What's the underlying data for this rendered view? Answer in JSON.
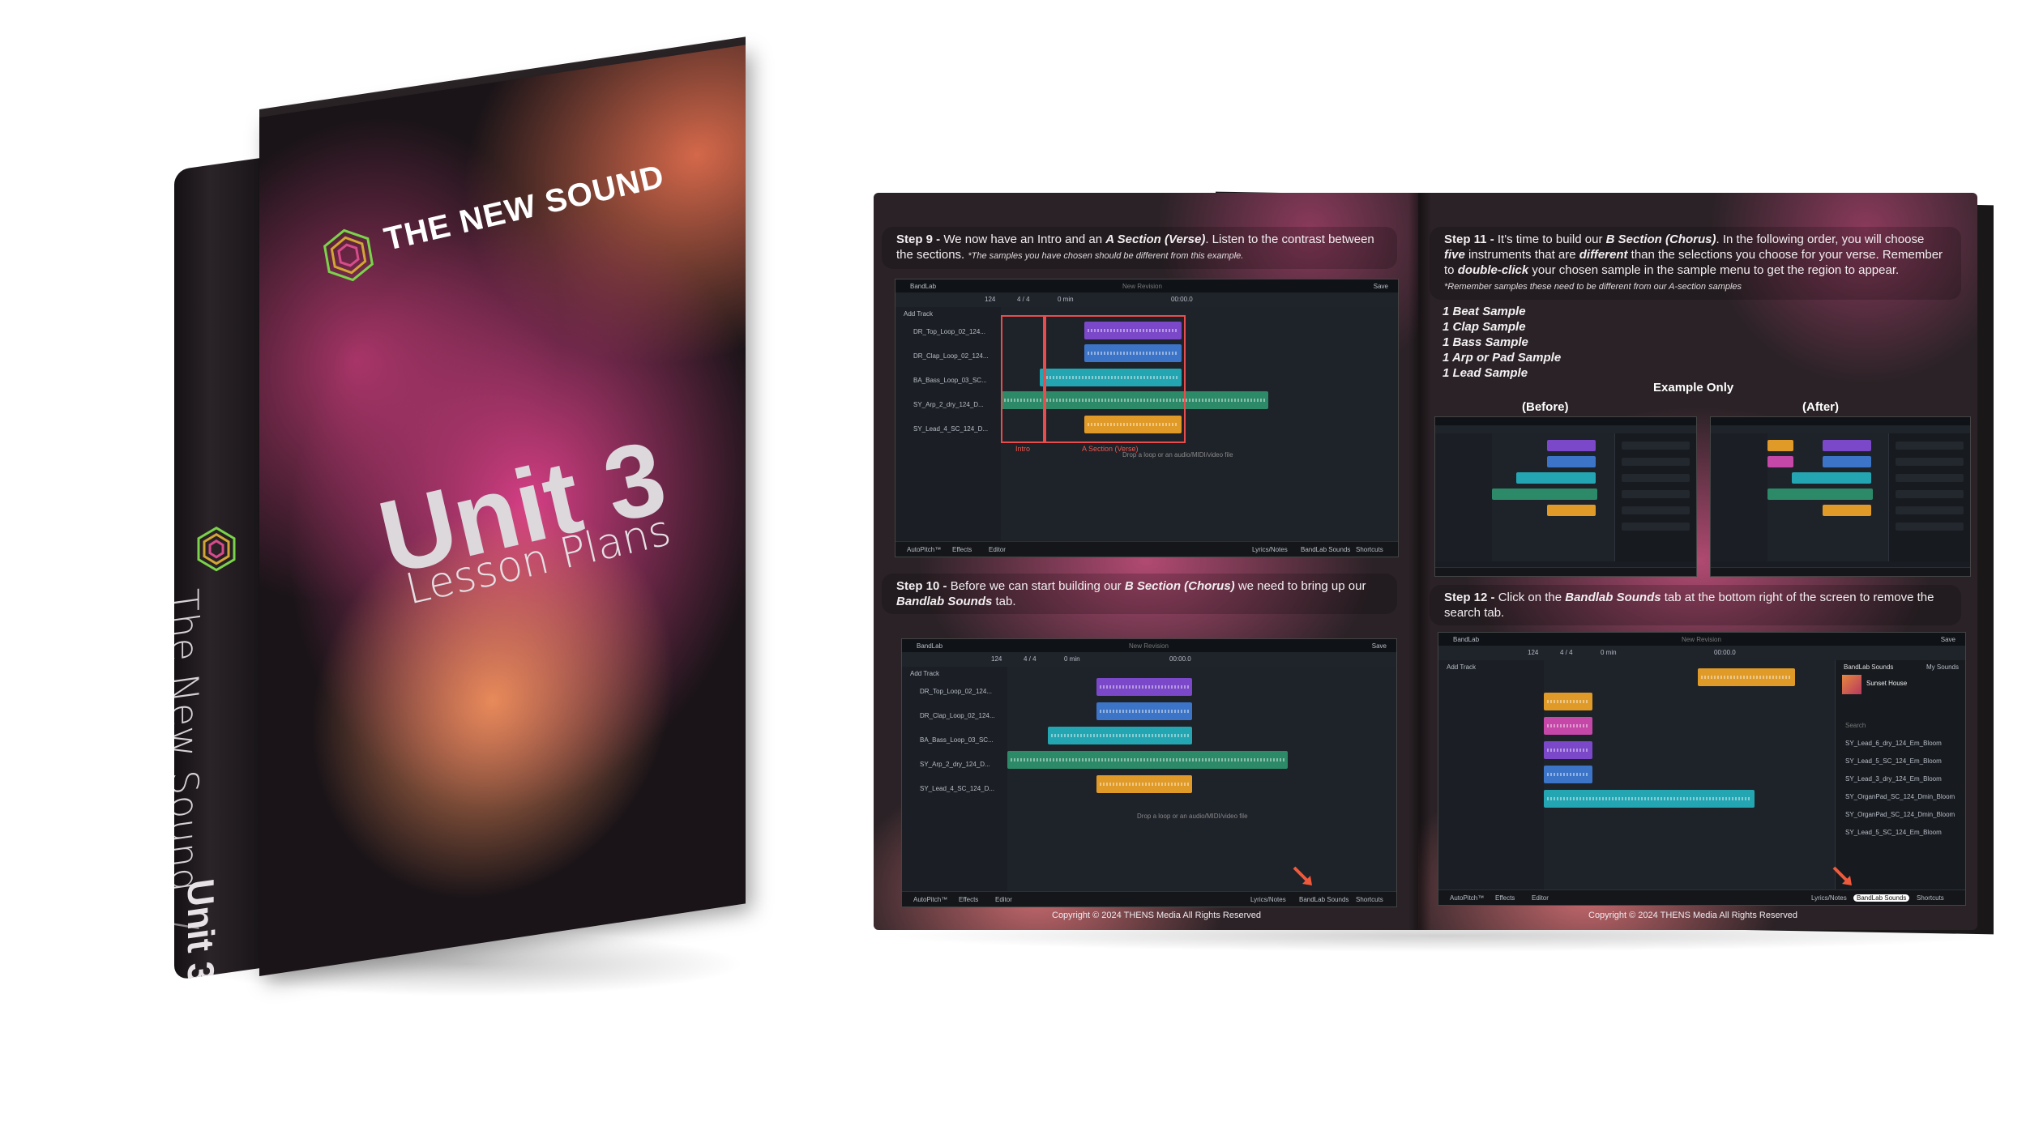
{
  "book": {
    "cover_title": "THE NEW SOUND",
    "cover_unit": "Unit 3",
    "cover_subtitle": "Lesson Plans",
    "spine_title": "The New Sound",
    "spine_divider": "/",
    "spine_unit": "Unit 3",
    "logo_icon": "hexagon-spiral-logo-icon"
  },
  "workbook": {
    "step9": {
      "label": "Step 9 -",
      "text_a": " We now have an Intro and an ",
      "emph": "A Section (Verse)",
      "text_b": ". Listen to the contrast between the sections. ",
      "note": "*The samples you have chosen should be different from this example."
    },
    "step10": {
      "label": "Step 10 -",
      "text_a": " Before we can start building our ",
      "emph": "B Section (Chorus)",
      "text_b": " we need to bring up our ",
      "emph2": "Bandlab Sounds",
      "text_c": " tab."
    },
    "step11": {
      "label": "Step 11 -",
      "text_a": " It's time to build our ",
      "emph": "B Section (Chorus)",
      "text_b": ". In the following order, you will choose ",
      "emph2": "five",
      "text_c": " instruments that are ",
      "emph3": "different",
      "text_d": " than the selections you choose for your verse. Remember to ",
      "emph4": "double-click",
      "text_e": " your chosen sample in the sample menu to get the region to appear. ",
      "note": "*Remember samples these need to be different from our A-section samples"
    },
    "step11_list": [
      "1 Beat Sample",
      "1 Clap Sample",
      "1 Bass Sample",
      "1 Arp or Pad  Sample",
      "1 Lead Sample"
    ],
    "example_label": "Example Only",
    "before_label": "(Before)",
    "after_label": "(After)",
    "step12": {
      "label": "Step 12 -",
      "text_a": " Click on the ",
      "emph": "Bandlab Sounds",
      "text_b": " tab at the bottom right of the screen to remove the search tab."
    },
    "copyright_left": "Copyright © 2024 THENS Media All Rights Reserved",
    "copyright_right": "Copyright © 2024 THENS Media All Rights Reserved",
    "daw": {
      "app_name": "BandLab",
      "project": "New Revision",
      "save": "Save",
      "bpm": "124",
      "sig": "4 / 4",
      "time": "0 min",
      "clock": "00:00.0",
      "add_track": "Add Track",
      "drop_hint": "Drop a loop or an audio/MIDI/video file",
      "intro_label": "Intro",
      "verse_label": "A Section (Verse)",
      "bottom_items": [
        "AutoPitch™",
        "Effects",
        "Editor",
        "Lyrics/Notes",
        "BandLab Sounds",
        "Shortcuts"
      ],
      "tracks_a": [
        "DR_Top_Loop_02_124...",
        "DR_Clap_Loop_02_124...",
        "BA_Bass_Loop_03_SC...",
        "SY_Arp_2_dry_124_D...",
        "SY_Lead_4_SC_124_D..."
      ],
      "panel_title": "BandLab Sounds",
      "panel_tab": "My Sounds",
      "panel_pack": "Sunset House",
      "panel_search": "Search",
      "panel_items": [
        "SY_Lead_6_dry_124_Em_Bloom",
        "SY_Lead_5_SC_124_Em_Bloom",
        "SY_Lead_3_dry_124_Em_Bloom",
        "SY_OrganPad_SC_124_Dmin_Bloom",
        "SY_OrganPad_SC_124_Dmin_Bloom",
        "SY_Lead_5_SC_124_Em_Bloom"
      ]
    }
  },
  "colors": {
    "accent_red": "#e84d4d",
    "clip_purple": "#7a48c8",
    "clip_blue": "#3c74c8",
    "clip_teal": "#23a6b2",
    "clip_green": "#2c8a68",
    "clip_orange": "#e09a28"
  }
}
